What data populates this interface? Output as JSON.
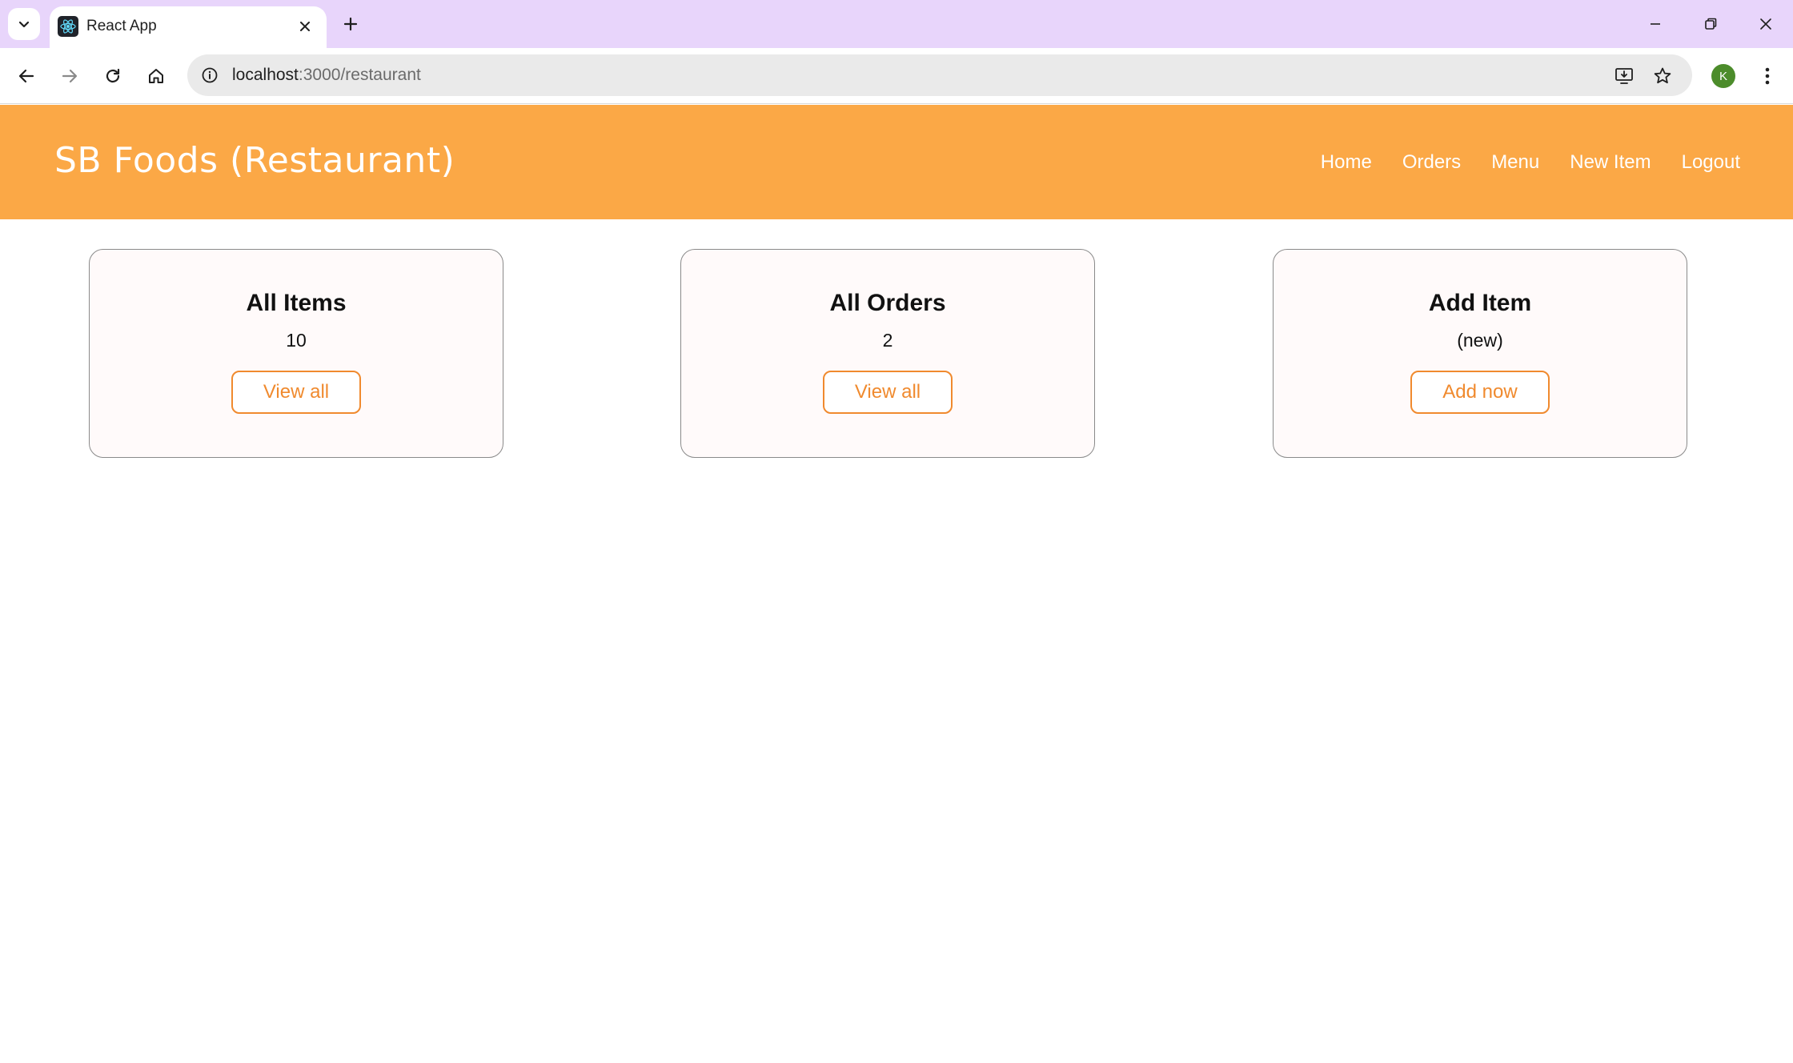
{
  "browser": {
    "tab_title": "React App",
    "url_host": "localhost",
    "url_path": ":3000/restaurant",
    "profile_initial": "K"
  },
  "header": {
    "brand": "SB Foods (Restaurant)",
    "nav": [
      "Home",
      "Orders",
      "Menu",
      "New Item",
      "Logout"
    ]
  },
  "cards": [
    {
      "title": "All Items",
      "value": "10",
      "button": "View all"
    },
    {
      "title": "All Orders",
      "value": "2",
      "button": "View all"
    },
    {
      "title": "Add Item",
      "value": "(new)",
      "button": "Add now"
    }
  ],
  "colors": {
    "header_bg": "#fba846",
    "accent": "#f08a2e",
    "tabbar_bg": "#e8d5fb"
  }
}
